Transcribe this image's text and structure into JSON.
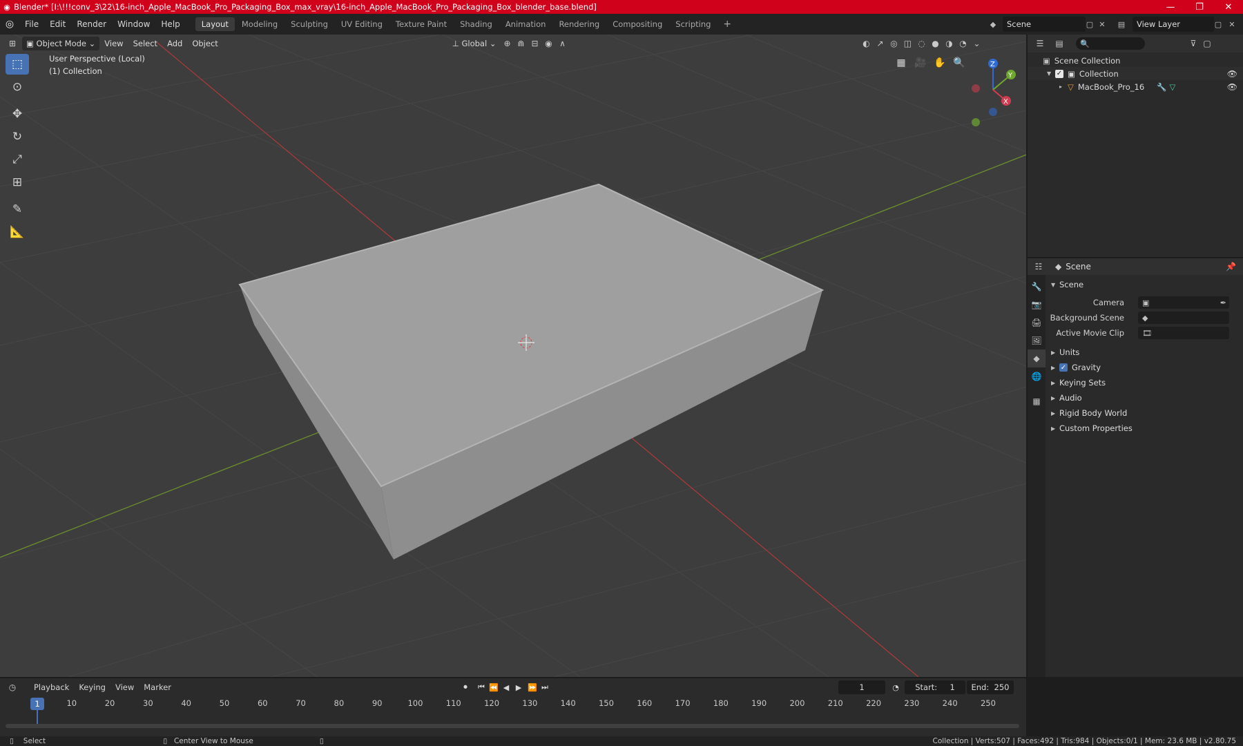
{
  "window": {
    "title": "Blender* [I:\\!!!conv_3\\22\\16-inch_Apple_MacBook_Pro_Packaging_Box_max_vray\\16-inch_Apple_MacBook_Pro_Packaging_Box_blender_base.blend]",
    "minimize": "—",
    "maximize": "❐",
    "close": "✕"
  },
  "menu": [
    "File",
    "Edit",
    "Render",
    "Window",
    "Help"
  ],
  "workspaces": [
    "Layout",
    "Modeling",
    "Sculpting",
    "UV Editing",
    "Texture Paint",
    "Shading",
    "Animation",
    "Rendering",
    "Compositing",
    "Scripting"
  ],
  "workspace_add": "+",
  "scene_selector": {
    "value": "Scene"
  },
  "view_layer_selector": {
    "value": "View Layer"
  },
  "viewport": {
    "mode": "Object Mode",
    "menus": [
      "View",
      "Select",
      "Add",
      "Object"
    ],
    "transform_orientation": "Global",
    "info_line1": "User Perspective (Local)",
    "info_line2": "(1) Collection",
    "gizmo": {
      "z": "Z",
      "y": "Y",
      "x": "X"
    }
  },
  "outliner": {
    "search_placeholder": "",
    "root": "Scene Collection",
    "collection": "Collection",
    "object": "MacBook_Pro_16"
  },
  "properties": {
    "header_scene": "Scene",
    "panel_title": "Scene",
    "fields": [
      {
        "label": "Camera",
        "value": ""
      },
      {
        "label": "Background Scene",
        "value": ""
      },
      {
        "label": "Active Movie Clip",
        "value": ""
      }
    ],
    "subpanels": [
      "Units",
      "Gravity",
      "Keying Sets",
      "Audio",
      "Rigid Body World",
      "Custom Properties"
    ],
    "gravity_checked": true
  },
  "timeline": {
    "menus": [
      "Playback",
      "Keying",
      "View",
      "Marker"
    ],
    "current_frame": "1",
    "start_label": "Start:",
    "start_value": "1",
    "end_label": "End:",
    "end_value": "250",
    "ruler_ticks": [
      "10",
      "20",
      "30",
      "40",
      "50",
      "60",
      "70",
      "80",
      "90",
      "100",
      "110",
      "120",
      "130",
      "140",
      "150",
      "160",
      "170",
      "180",
      "190",
      "200",
      "210",
      "220",
      "230",
      "240",
      "250"
    ],
    "playhead": "1"
  },
  "statusbar": {
    "left_action": "Select",
    "middle_action": "Center View to Mouse",
    "stats": "Collection | Verts:507 | Faces:492 | Tris:984 | Objects:0/1 | Mem: 23.6 MB | v2.80.75"
  }
}
